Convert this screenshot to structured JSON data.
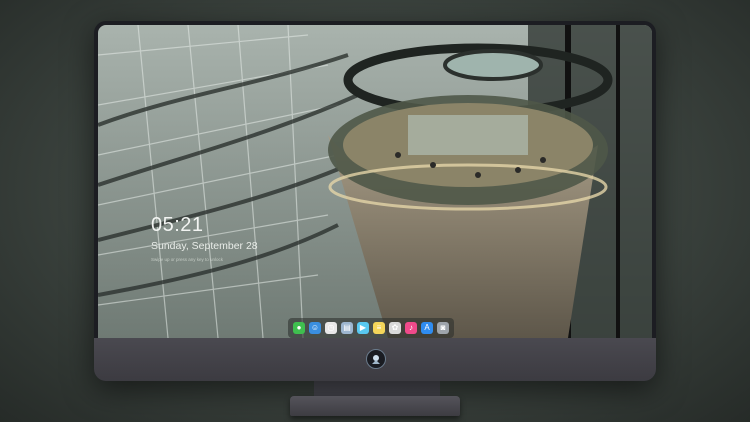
{
  "lock_screen": {
    "time": "05:21",
    "date": "Sunday, September 28",
    "hint": "Swipe up or press any key to unlock"
  },
  "dock": {
    "apps": [
      {
        "name": "messages-icon",
        "color": "#3fbf4f",
        "glyph": "●"
      },
      {
        "name": "finder-icon",
        "color": "#3a8fe0",
        "glyph": "☺"
      },
      {
        "name": "clock-icon",
        "color": "#e8e8e8",
        "glyph": "◷"
      },
      {
        "name": "files-icon",
        "color": "#9db6cf",
        "glyph": "▤"
      },
      {
        "name": "video-icon",
        "color": "#59c9f0",
        "glyph": "▶"
      },
      {
        "name": "notes-icon",
        "color": "#f4d65a",
        "glyph": "≡"
      },
      {
        "name": "photos-icon",
        "color": "#d9d9d9",
        "glyph": "✿"
      },
      {
        "name": "music-icon",
        "color": "#f04a8a",
        "glyph": "♪"
      },
      {
        "name": "appstore-icon",
        "color": "#2f8cf0",
        "glyph": "A"
      },
      {
        "name": "camera-icon",
        "color": "#9ea4ab",
        "glyph": "◙"
      }
    ]
  },
  "colors": {
    "bezel": "#1c1d22",
    "chin": "#44434a",
    "background": "#3f4742"
  }
}
